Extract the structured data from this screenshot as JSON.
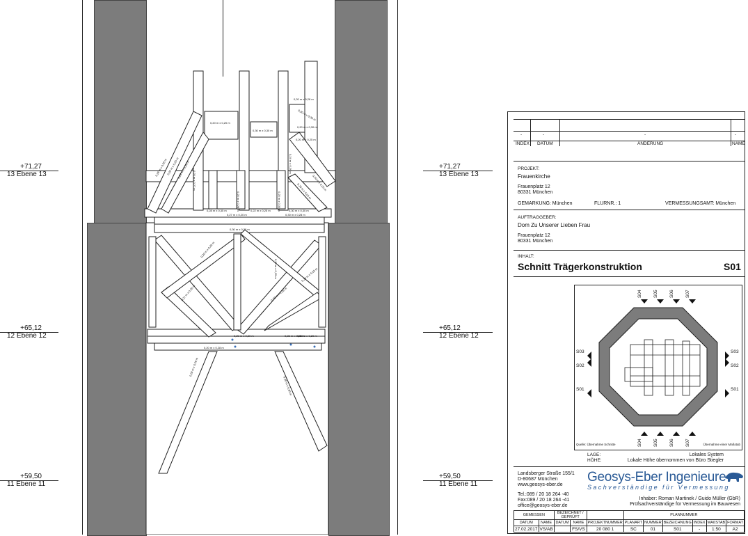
{
  "levels": [
    {
      "elev": "+71,27",
      "name": "13 Ebene 13"
    },
    {
      "elev": "+65,12",
      "name": "12 Ebene 12"
    },
    {
      "elev": "+59,50",
      "name": "11 Ebene 11"
    }
  ],
  "dimensions": [
    "0,20 m x 0,20 m",
    "0,30 m x 0,30 m",
    "0,20 m x 0,28 m",
    "0,20 m x 0,30 m",
    "0,20 m x 0,25 m",
    "0,24 m x 0,26 m",
    "0,28 m x 0,35 m",
    "0,22 m x 0,25 m",
    "0,30 m x 0,30 m",
    "0,27 m x 0,20 m",
    "0,30 m x 0,28 m",
    "0,30 m x 0,20 m",
    "0,25 m x 0,27 m",
    "0,30 m x 0,20 m",
    "0,28 m x 0,28 m",
    "0,20 m x 0,28 m",
    "0,20 m x 0,30 m",
    "0,20 m x 0,20 m",
    "0,20 m x 0,20 m",
    "0,20 m x 0,20 m",
    "0,20 m x 0,25 m",
    "0,27 m x 0,25 m",
    "0,20 m x 0,28 m",
    "0,28 m x 0,28 m",
    "0,20 m x 0,28 m",
    "0,20 m x 0,20 m",
    "0,28 m x 0,28 m",
    "0,20 m x 0,20 m",
    "0,28 m x 0,28 m",
    "0,30 m x 0,30 m",
    "0,28 m x 0,28 m",
    "0,20 m x 0,30 m"
  ],
  "title_block": {
    "rev_header": {
      "index": "INDEX",
      "datum": "DATUM",
      "aenderung": "ÄNDERUNG",
      "name": "NAME",
      "dash": "-"
    },
    "projekt_label": "PROJEKT:",
    "projekt_name": "Frauenkirche",
    "projekt_street": "Frauenplatz 12",
    "projekt_city": "80331 München",
    "gemarkung": "GEMARKUNG: München",
    "flurnr": "FLURNR.: 1",
    "vermessungsamt": "VERMESSUNGSAMT: München",
    "auftraggeber_label": "AUFTRAGGEBER:",
    "auftraggeber_name": "Dom Zu Unserer Lieben Frau",
    "auftraggeber_street": "Frauenplatz 12",
    "auftraggeber_city": "80331 München",
    "inhalt_label": "INHALT:",
    "inhalt_title": "Schnitt Trägerkonstruktion",
    "plan_code": "S01",
    "inset_marks_top": [
      "S04",
      "S05",
      "S06",
      "S07"
    ],
    "inset_marks_bottom": [
      "S04",
      "S05",
      "S06",
      "S07"
    ],
    "inset_marks_left": [
      "S03",
      "S02",
      "S01"
    ],
    "inset_marks_right": [
      "S03",
      "S02",
      "S01"
    ],
    "inset_caption_left": "Quelle: Übernahme Schnitte",
    "inset_caption_right": "Übernahme einer Maßstab",
    "lage_label": "LAGE:",
    "lage_value": "Lokales System",
    "hoehe_label": "HÖHE:",
    "hoehe_value": "Lokale Höhe übernommen von Büro Stiegler",
    "company_addr1": "Landsberger Straße 155/1",
    "company_addr2": "D-80687 München",
    "company_web": "www.geosys-eber.de",
    "company_tel": "Tel.:089 / 20 18 264 -40",
    "company_fax": "Fax:089 / 20 18 264 -41",
    "company_mail": "office@geosys-eber.de",
    "brand_main": "Geosys-Eber Ingenieure",
    "brand_sub": "Sachverständige für Vermessung",
    "owners": "Inhaber: Roman Martinek / Guido Müller (GbR)",
    "owners_sub": "Prüfsachverständige für Vermessung im Bauwesen",
    "grid_headers": [
      "DATUM",
      "NAME",
      "DATUM",
      "NAME",
      "PROJEKTNUMMER",
      "PLANART",
      "NUMMER",
      "BEZEICHNUNG",
      "INDEX",
      "MAßSTAB",
      "FORMAT"
    ],
    "grid_group": [
      "GEMESSEN",
      "BEZEICHNET / GEPRÜFT",
      "PLANNUMMER"
    ],
    "grid_values": [
      "27.02.2017",
      "VS/AB",
      "",
      "FS/VS",
      "20 080 1",
      "SC",
      "01",
      "S01",
      "-",
      "1:50",
      "A2"
    ]
  }
}
